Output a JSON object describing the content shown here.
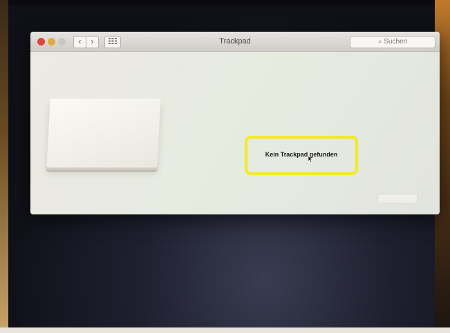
{
  "window": {
    "title": "Trackpad",
    "search_placeholder": "Suchen",
    "nav": {
      "back_icon": "chevron-left-icon",
      "forward_icon": "chevron-right-icon",
      "grid_icon": "grid-icon"
    }
  },
  "content": {
    "message": "Kein Trackpad gefunden"
  },
  "colors": {
    "highlight": "#f4ea1f",
    "traffic_red": "#e0443e",
    "traffic_yellow": "#e7a93a"
  }
}
